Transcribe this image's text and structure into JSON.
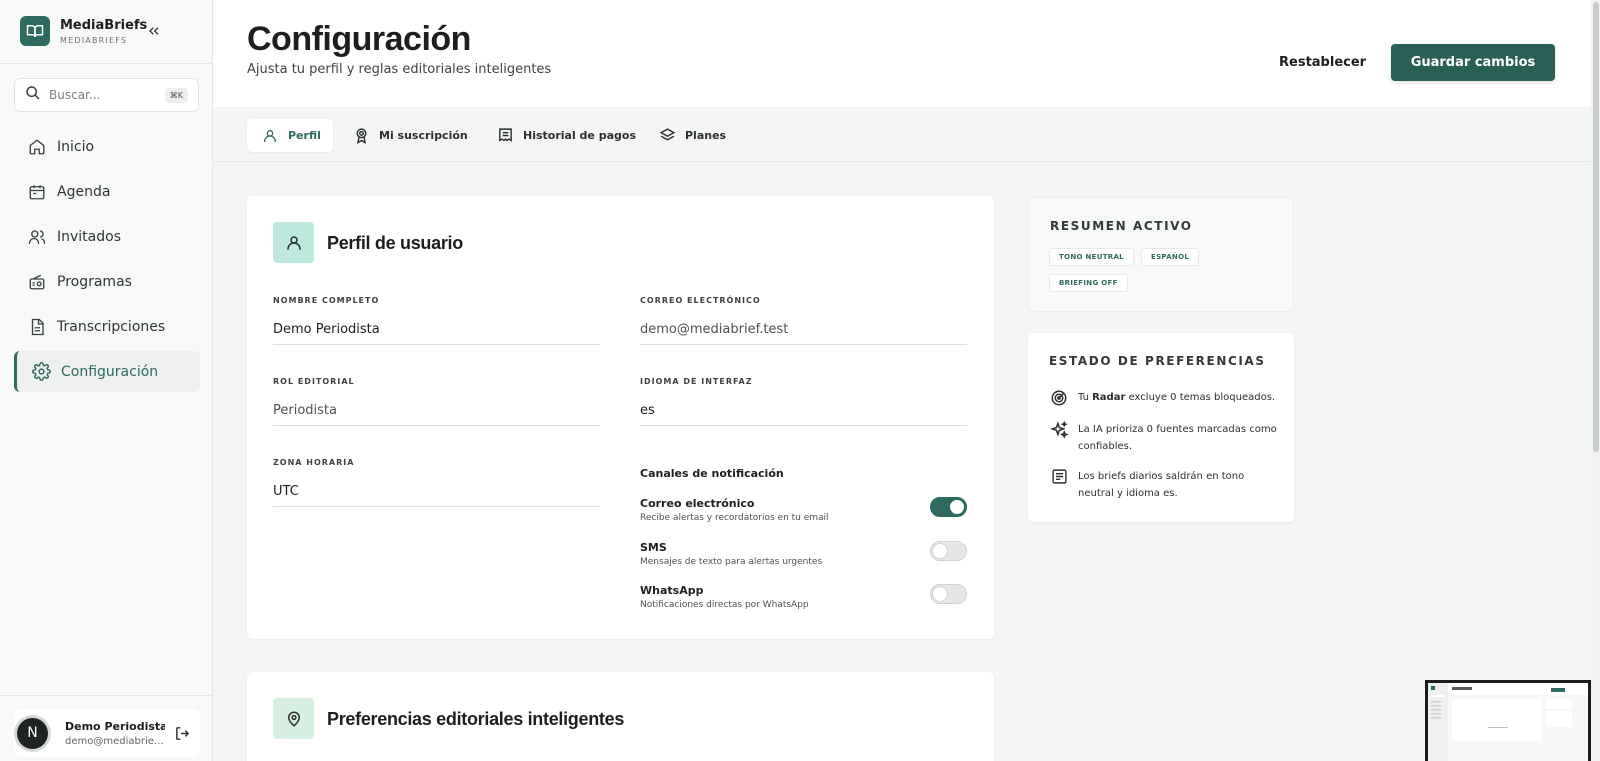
{
  "brand": {
    "name": "MediaBriefs",
    "subtitle": "MEDIABRIEFS"
  },
  "search": {
    "placeholder": "Buscar...",
    "shortcut": "⌘K"
  },
  "nav": {
    "items": [
      {
        "label": "Inicio",
        "icon": "home-icon"
      },
      {
        "label": "Agenda",
        "icon": "calendar-icon"
      },
      {
        "label": "Invitados",
        "icon": "users-icon"
      },
      {
        "label": "Programas",
        "icon": "radio-icon"
      },
      {
        "label": "Transcripciones",
        "icon": "document-icon"
      },
      {
        "label": "Configuración",
        "icon": "gear-icon",
        "active": true
      }
    ]
  },
  "user": {
    "initial": "N",
    "name": "Demo Periodista",
    "email": "demo@mediabrief.test"
  },
  "header": {
    "title": "Configuración",
    "subtitle": "Ajusta tu perfil y reglas editoriales inteligentes",
    "reset_label": "Restablecer",
    "save_label": "Guardar cambios"
  },
  "tabs": [
    {
      "label": "Perfil",
      "icon": "user-icon",
      "active": true
    },
    {
      "label": "Mi suscripción",
      "icon": "badge-icon"
    },
    {
      "label": "Historial de pagos",
      "icon": "receipt-icon"
    },
    {
      "label": "Planes",
      "icon": "layers-icon"
    }
  ],
  "profile": {
    "title": "Perfil de usuario",
    "fields": {
      "full_name": {
        "label": "NOMBRE COMPLETO",
        "value": "Demo Periodista"
      },
      "email": {
        "label": "CORREO ELECTRÓNICO",
        "value": "demo@mediabrief.test"
      },
      "role": {
        "label": "ROL EDITORIAL",
        "value": "Periodista"
      },
      "language": {
        "label": "IDIOMA DE INTERFAZ",
        "value": "es"
      },
      "timezone": {
        "label": "ZONA HORARIA",
        "value": "UTC"
      }
    },
    "notifications": {
      "title": "Canales de notificación",
      "channels": [
        {
          "name": "Correo electrónico",
          "description": "Recibe alertas y recordatorios en tu email",
          "enabled": true
        },
        {
          "name": "SMS",
          "description": "Mensajes de texto para alertas urgentes",
          "enabled": false
        },
        {
          "name": "WhatsApp",
          "description": "Notificaciones directas por WhatsApp",
          "enabled": false
        }
      ]
    }
  },
  "preferences": {
    "title": "Preferencias editoriales inteligentes"
  },
  "summary": {
    "title": "RESUMEN ACTIVO",
    "chips": [
      "TONO NEUTRAL",
      "ESPAÑOL",
      "BRIEFING OFF"
    ]
  },
  "state": {
    "title": "ESTADO DE PREFERENCIAS",
    "rows": [
      {
        "icon": "radar-icon",
        "pre": "Tu ",
        "bold": "Radar",
        "post": " excluye 0 temas bloqueados."
      },
      {
        "icon": "sparkles-icon",
        "pre": "La IA prioriza 0 fuentes marcadas como confiables.",
        "bold": "",
        "post": ""
      },
      {
        "icon": "list-icon",
        "pre": "Los briefs diarios saldrán en tono neutral y idioma es.",
        "bold": "",
        "post": ""
      }
    ]
  },
  "colors": {
    "accent": "#2e6a5f",
    "accent_light": "#bfe9df",
    "accent_lighter": "#d6f1e2"
  }
}
